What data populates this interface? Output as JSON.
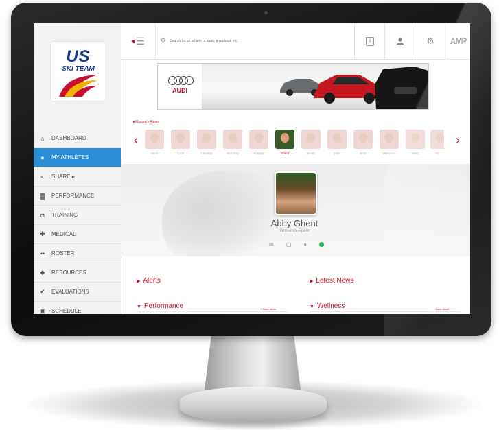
{
  "sidebar": {
    "logo": {
      "top": "US",
      "bottom": "SKI TEAM"
    },
    "items": [
      {
        "label": "DASHBOARD",
        "icon": "house-icon",
        "glyph": "⌂"
      },
      {
        "label": "MY ATHLETES",
        "icon": "person-icon",
        "glyph": "●",
        "active": true
      },
      {
        "label": "SHARE ▸",
        "icon": "share-icon",
        "glyph": "<"
      },
      {
        "label": "PERFORMANCE",
        "icon": "chart-icon",
        "glyph": "▓"
      },
      {
        "label": "TRAINING",
        "icon": "dumbbell-icon",
        "glyph": "◘"
      },
      {
        "label": "MEDICAL",
        "icon": "medical-cross-icon",
        "glyph": "✚"
      },
      {
        "label": "ROSTER",
        "icon": "group-icon",
        "glyph": "••"
      },
      {
        "label": "RESOURCES",
        "icon": "tag-icon",
        "glyph": "◆"
      },
      {
        "label": "EVALUATIONS",
        "icon": "check-icon",
        "glyph": "✔"
      },
      {
        "label": "SCHEDULE",
        "icon": "calendar-icon",
        "glyph": "▣"
      }
    ]
  },
  "topbar": {
    "search_placeholder": "Search for an athlete, a team, a workout, etc.",
    "calendar_day": "1",
    "amp_label": "AMP"
  },
  "banner": {
    "brand": "AUDI"
  },
  "athletes": {
    "group_label": "Women's Alpine",
    "list": [
      {
        "name": "Vonn"
      },
      {
        "name": "Cook"
      },
      {
        "name": "Lapanja"
      },
      {
        "name": "Mcfrosky"
      },
      {
        "name": "Stiegler"
      },
      {
        "name": "Ghent",
        "selected": true
      },
      {
        "name": "Smith"
      },
      {
        "name": "Irwin"
      },
      {
        "name": "Ford"
      },
      {
        "name": "Mancuso"
      },
      {
        "name": "Wiles"
      },
      {
        "name": "Mc"
      }
    ]
  },
  "profile": {
    "name": "Abby Ghent",
    "team": "Women's Alpine",
    "status_color": "#28b44b"
  },
  "sections": {
    "alerts": "Alerts",
    "latest_news": "Latest News",
    "performance": "Performance",
    "wellness": "Wellness",
    "more_detail": "+ More detail"
  },
  "colors": {
    "accent": "#c8102e",
    "active_nav": "#2c8fd6"
  }
}
